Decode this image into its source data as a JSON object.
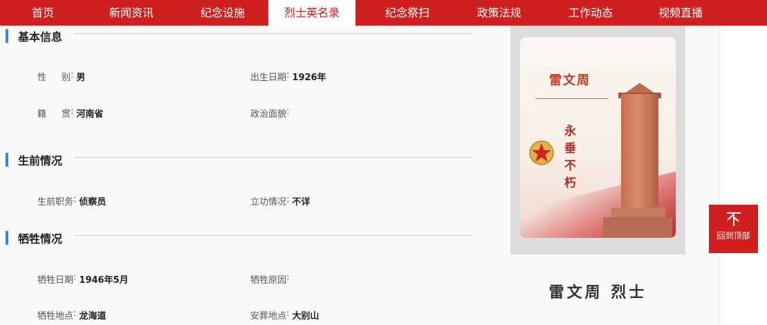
{
  "nav": {
    "items": [
      {
        "label": "首页"
      },
      {
        "label": "新闻资讯"
      },
      {
        "label": "纪念设施"
      },
      {
        "label": "烈士英名录"
      },
      {
        "label": "纪念祭扫"
      },
      {
        "label": "政策法规"
      },
      {
        "label": "工作动态"
      },
      {
        "label": "视频直播"
      }
    ],
    "active_index": 3
  },
  "sections": {
    "basic": {
      "title": "基本信息",
      "gender_label": "性别",
      "gender_value": "男",
      "birth_label": "出生日期",
      "birth_value": "1926年",
      "native_label": "籍贯",
      "native_value": "河南省",
      "political_label": "政治面貌",
      "political_value": ""
    },
    "life": {
      "title": "生前情况",
      "position_label": "生前职务",
      "position_value": "侦察员",
      "merit_label": "立功情况",
      "merit_value": "不详"
    },
    "sacrifice": {
      "title": "牺牲情况",
      "date_label": "牺牲日期",
      "date_value": "1946年5月",
      "cause_label": "牺牲原因",
      "cause_value": "",
      "place_label": "牺牲地点",
      "place_value": "龙海道",
      "burial_label": "安葬地点",
      "burial_value": "大别山"
    }
  },
  "portrait": {
    "name": "雷文周",
    "motto": "永垂不朽"
  },
  "martyr_title": "雷文周 烈士",
  "back_to_top": {
    "arrow": "不",
    "label": "回到顶部"
  },
  "colors": {
    "nav_bg": "#cf1f1f",
    "accent_bar": "#3a87d4",
    "back_top_bg": "#cf1f1f"
  },
  "icons": {
    "star": "star-emblem-icon",
    "back_top": "arrow-up-icon"
  }
}
